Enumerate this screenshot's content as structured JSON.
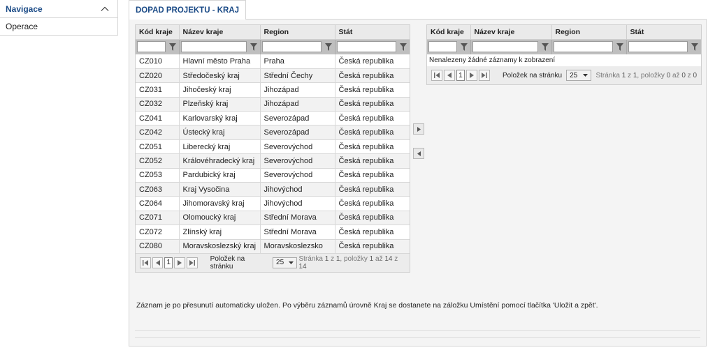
{
  "sidebar": {
    "title": "Navigace",
    "items": [
      {
        "label": "Operace"
      }
    ]
  },
  "tab": {
    "label": "DOPAD PROJEKTU - KRAJ"
  },
  "grid_left": {
    "columns": [
      "Kód kraje",
      "Název kraje",
      "Region",
      "Stát"
    ],
    "rows": [
      [
        "CZ010",
        "Hlavní město Praha",
        "Praha",
        "Česká republika"
      ],
      [
        "CZ020",
        "Středočeský kraj",
        "Střední Čechy",
        "Česká republika"
      ],
      [
        "CZ031",
        "Jihočeský kraj",
        "Jihozápad",
        "Česká republika"
      ],
      [
        "CZ032",
        "Plzeňský kraj",
        "Jihozápad",
        "Česká republika"
      ],
      [
        "CZ041",
        "Karlovarský kraj",
        "Severozápad",
        "Česká republika"
      ],
      [
        "CZ042",
        "Ústecký kraj",
        "Severozápad",
        "Česká republika"
      ],
      [
        "CZ051",
        "Liberecký kraj",
        "Severovýchod",
        "Česká republika"
      ],
      [
        "CZ052",
        "Královéhradecký kraj",
        "Severovýchod",
        "Česká republika"
      ],
      [
        "CZ053",
        "Pardubický kraj",
        "Severovýchod",
        "Česká republika"
      ],
      [
        "CZ063",
        "Kraj Vysočina",
        "Jihovýchod",
        "Česká republika"
      ],
      [
        "CZ064",
        "Jihomoravský kraj",
        "Jihovýchod",
        "Česká republika"
      ],
      [
        "CZ071",
        "Olomoucký kraj",
        "Střední Morava",
        "Česká republika"
      ],
      [
        "CZ072",
        "Zlínský kraj",
        "Střední Morava",
        "Česká republika"
      ],
      [
        "CZ080",
        "Moravskoslezský kraj",
        "Moravskoslezsko",
        "Česká republika"
      ]
    ],
    "pager": {
      "page": "1",
      "page_size_label": "Položek na stránku",
      "page_size": "25",
      "info_prefix": "Stránka",
      "info_page": "1",
      "info_of": "z",
      "info_pages": "1",
      "info_items": ", položky",
      "info_from": "1",
      "info_to_word": "až",
      "info_to": "14",
      "info_total_word": "z",
      "info_total": "14"
    }
  },
  "grid_right": {
    "columns": [
      "Kód kraje",
      "Název kraje",
      "Region",
      "Stát"
    ],
    "empty_message": "Nenalezeny žádné záznamy k zobrazení",
    "pager": {
      "page": "1",
      "page_size_label": "Položek na stránku",
      "page_size": "25",
      "info_prefix": "Stránka",
      "info_page": "1",
      "info_of": "z",
      "info_pages": "1",
      "info_items": ", položky",
      "info_from": "0",
      "info_to_word": "až",
      "info_to": "0",
      "info_total_word": "z",
      "info_total": "0"
    }
  },
  "note": "Záznam je po přesunutí automaticky uložen. Po výběru záznamů úrovně Kraj se dostanete na záložku Umístění pomocí tlačítka 'Uložit a zpět'.",
  "icons": {
    "collapse": "chevron-up-icon",
    "filter": "filter-icon",
    "first": "first-page-icon",
    "prev": "prev-page-icon",
    "next": "next-page-icon",
    "last": "last-page-icon",
    "move_right": "move-right-icon",
    "move_left": "move-left-icon"
  },
  "colors": {
    "accent": "#1a4a86",
    "filter_row": "#bfbfbf",
    "header_bg": "#eaeaea"
  }
}
